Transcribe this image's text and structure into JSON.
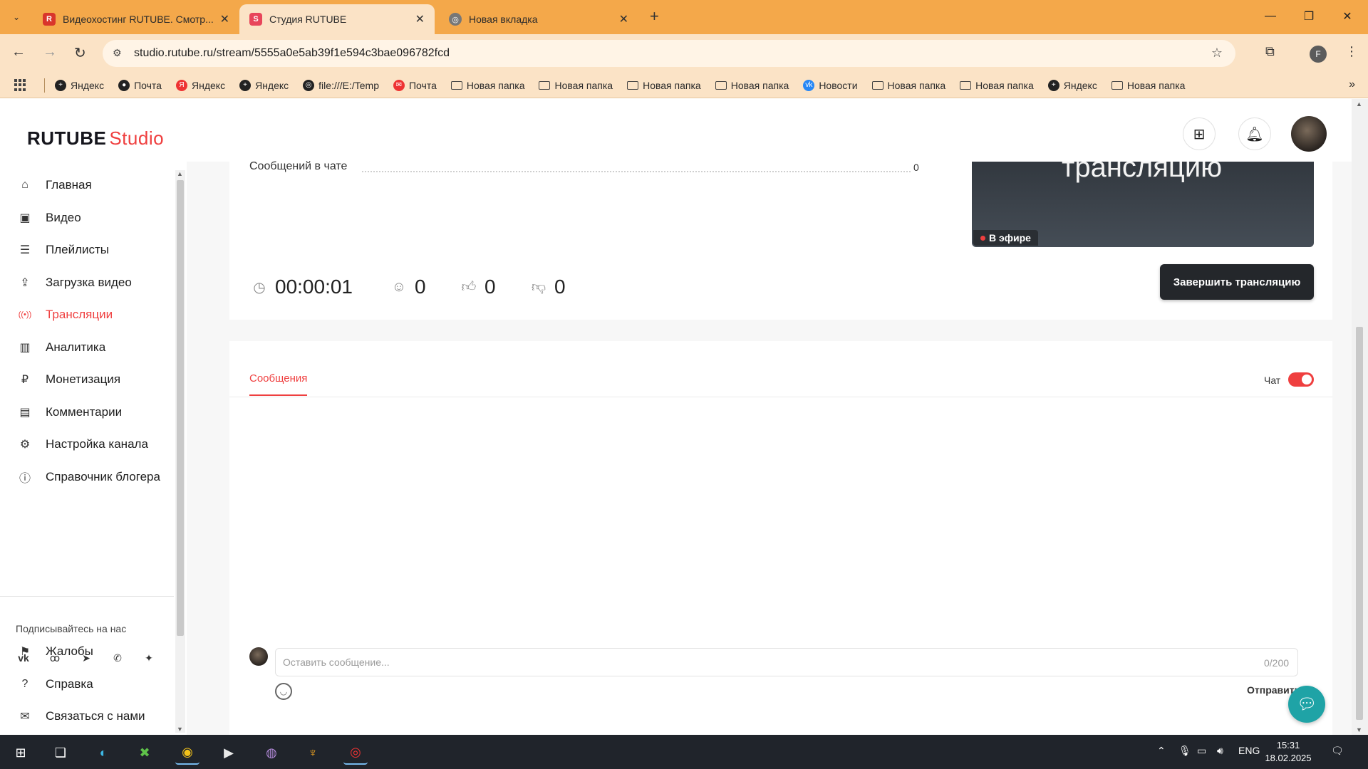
{
  "browser": {
    "tabs": [
      {
        "title": "Видеохостинг RUTUBE. Смотр...",
        "favicon": "R",
        "favicon_color": "#d9352b",
        "active": false
      },
      {
        "title": "Студия RUTUBE",
        "favicon": "S",
        "favicon_color": "#e8455a",
        "active": true
      },
      {
        "title": "Новая вкладка",
        "favicon": "chrome-icon",
        "favicon_color": "#555555",
        "active": false
      }
    ],
    "url": "studio.rutube.ru/stream/5555a0e5ab39f1e594c3bae096782fcd",
    "profile_letter": "F",
    "bookmarks": [
      {
        "label": "Яндекс",
        "icon": "plus-circle-icon"
      },
      {
        "label": "Почта",
        "icon": "circle-icon"
      },
      {
        "label": "Яндекс",
        "icon": "yandex-icon"
      },
      {
        "label": "Яндекс",
        "icon": "plus-circle-icon"
      },
      {
        "label": "file:///E:/Temp",
        "icon": "globe-icon"
      },
      {
        "label": "Почта",
        "icon": "mail-icon"
      },
      {
        "label": "Новая папка",
        "icon": "folder-icon"
      },
      {
        "label": "Новая папка",
        "icon": "folder-icon"
      },
      {
        "label": "Новая папка",
        "icon": "folder-icon"
      },
      {
        "label": "Новая папка",
        "icon": "folder-icon"
      },
      {
        "label": "Новости",
        "icon": "vk-icon"
      },
      {
        "label": "Новая папка",
        "icon": "folder-icon"
      },
      {
        "label": "Новая папка",
        "icon": "folder-icon"
      },
      {
        "label": "Яндекс",
        "icon": "plus-circle-icon"
      },
      {
        "label": "Новая папка",
        "icon": "folder-icon"
      }
    ]
  },
  "app": {
    "logo_main": "RUTUBE",
    "logo_sub": "Studio",
    "sidebar": {
      "items": [
        {
          "label": "Главная",
          "icon": "home-icon",
          "active": false
        },
        {
          "label": "Видео",
          "icon": "video-icon",
          "active": false
        },
        {
          "label": "Плейлисты",
          "icon": "list-icon",
          "active": false
        },
        {
          "label": "Загрузка видео",
          "icon": "upload-icon",
          "active": false
        },
        {
          "label": "Трансляции",
          "icon": "broadcast-icon",
          "active": true
        },
        {
          "label": "Аналитика",
          "icon": "analytics-icon",
          "active": false
        },
        {
          "label": "Монетизация",
          "icon": "ruble-icon",
          "active": false
        },
        {
          "label": "Комментарии",
          "icon": "comment-icon",
          "active": false
        },
        {
          "label": "Настройка канала",
          "icon": "gear-icon",
          "active": false
        },
        {
          "label": "Справочник блогера",
          "icon": "book-icon",
          "active": false
        }
      ],
      "follow_label": "Подписывайтесь на нас",
      "socials": [
        "vk-icon",
        "odnoklassniki-icon",
        "telegram-icon",
        "viber-icon",
        "dzen-icon"
      ],
      "bottom_items": [
        {
          "label": "Жалобы",
          "icon": "flag-icon"
        },
        {
          "label": "Справка",
          "icon": "help-icon"
        },
        {
          "label": "Связаться с нами",
          "icon": "mail-icon"
        }
      ]
    },
    "stream": {
      "chat_messages_label": "Сообщений в чате",
      "chat_messages_count": "0",
      "preview_text": "трансляцию",
      "live_label": "В эфире",
      "duration": "00:00:01",
      "viewers": "0",
      "likes": "0",
      "dislikes": "0",
      "end_button": "Завершить трансляцию"
    },
    "chat": {
      "tab_label": "Сообщения",
      "toggle_label": "Чат",
      "toggle_on": true,
      "input_placeholder": "Оставить сообщение...",
      "input_value": "",
      "counter": "0/200",
      "send_label": "Отправить"
    }
  },
  "taskbar": {
    "apps": [
      "windows-start-icon",
      "task-view-icon",
      "edge-icon",
      "xbox-icon",
      "chrome-icon",
      "media-player-icon",
      "tor-browser-icon",
      "game-icon",
      "obs-icon"
    ],
    "language": "ENG",
    "time": "15:31",
    "date": "18.02.2025"
  },
  "colors": {
    "accent": "#ef3f3f",
    "tabbar": "#f4a84a",
    "toolbar": "#fbe3c6",
    "end_button": "#24272b",
    "help_fab": "#1fa3a6",
    "taskbar": "#20242b"
  }
}
